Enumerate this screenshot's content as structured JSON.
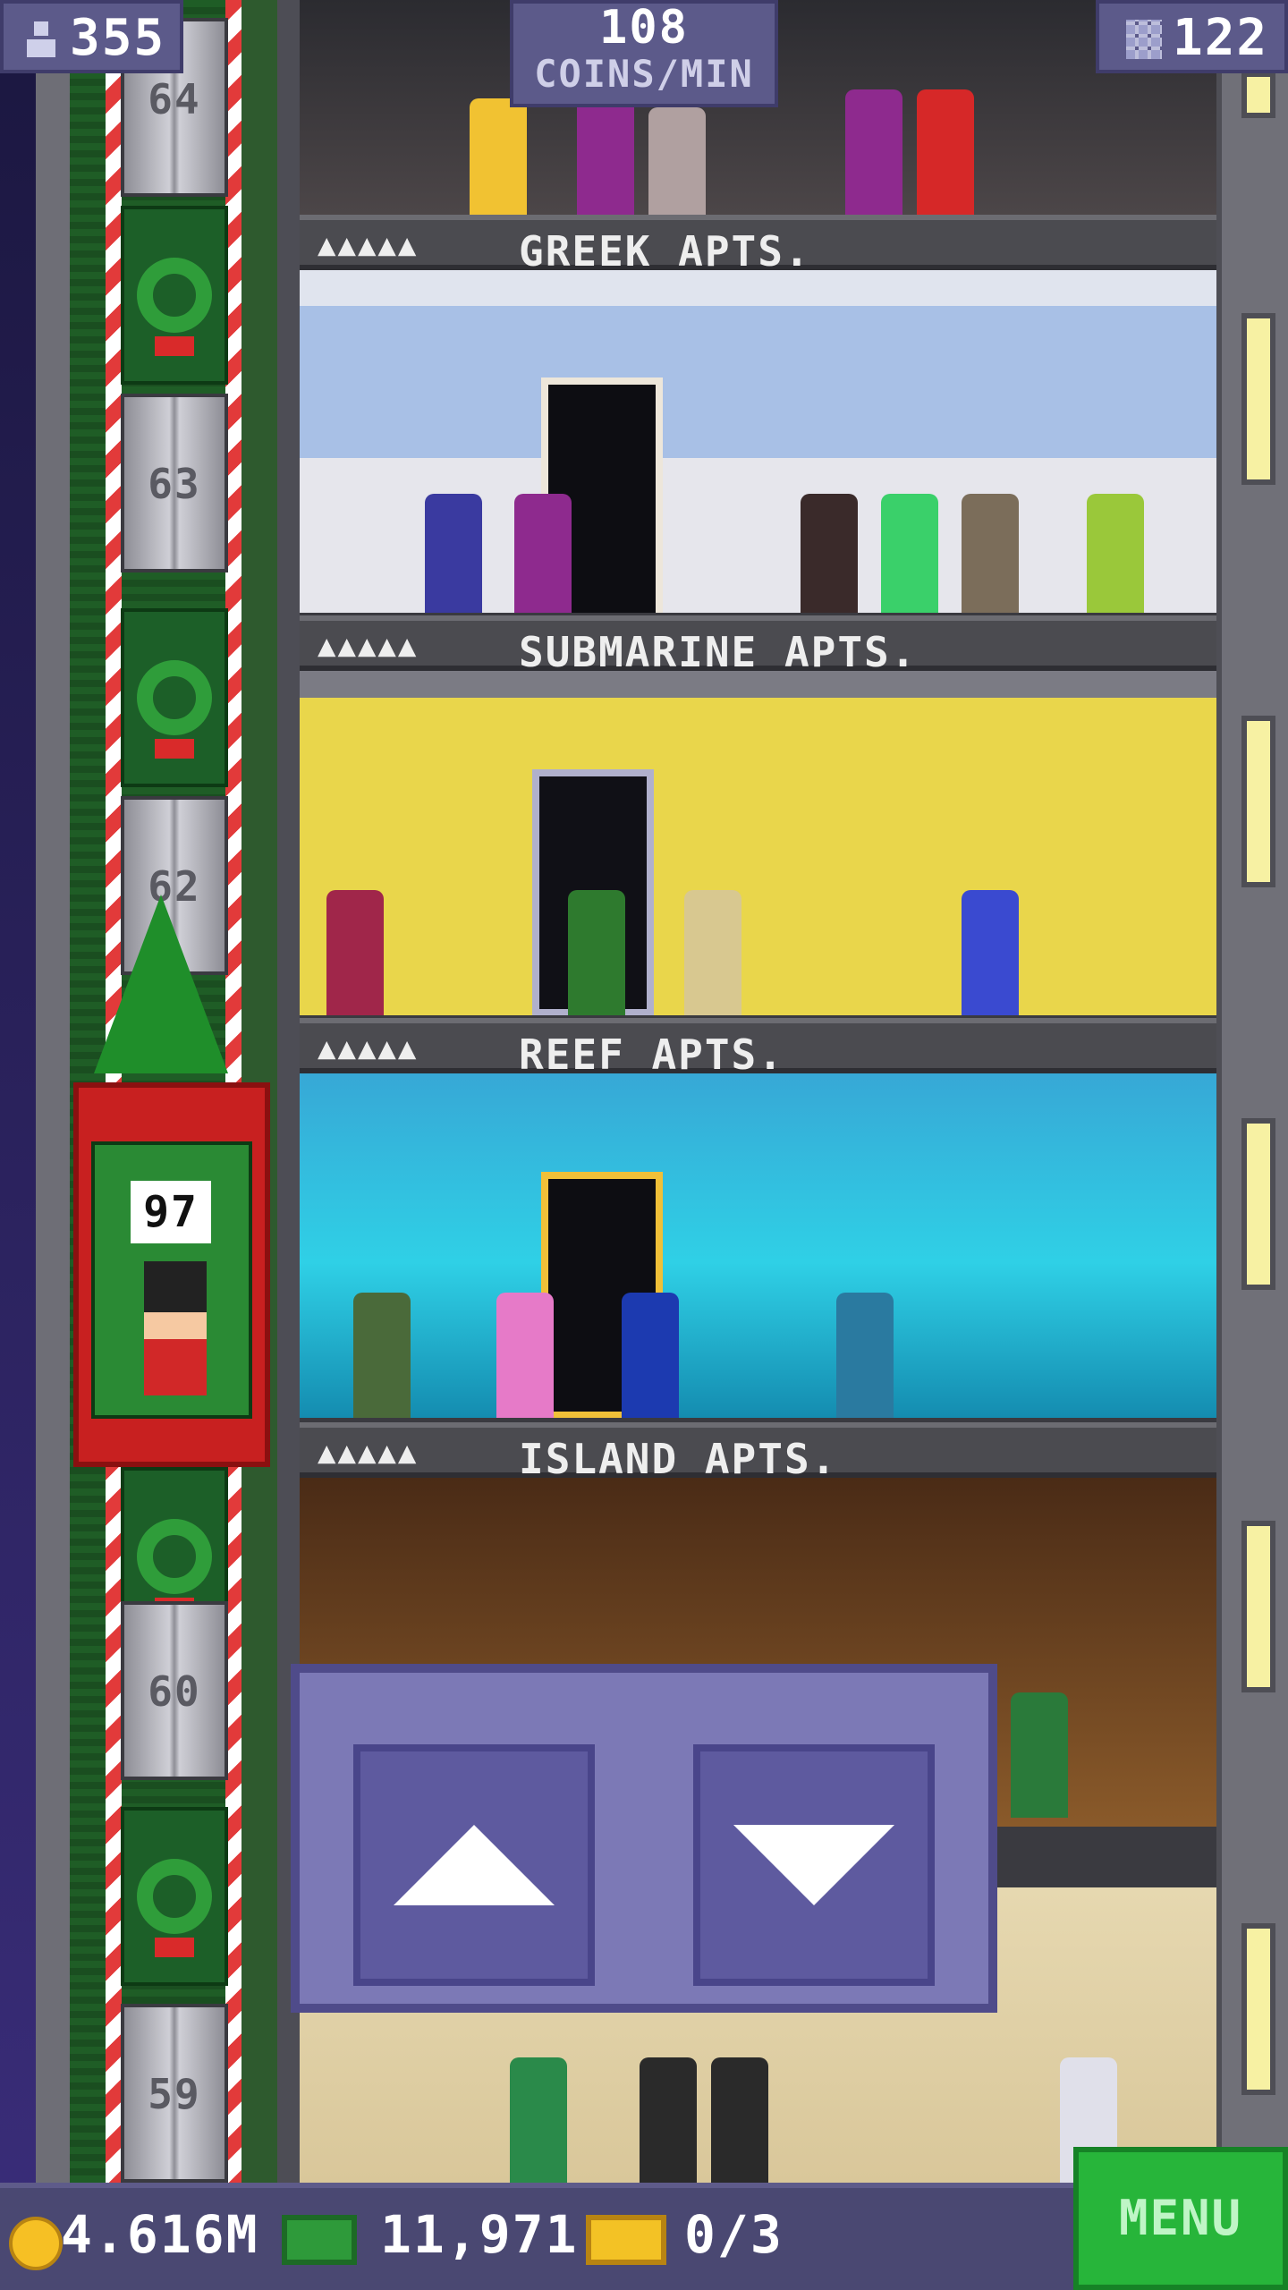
{
  "hud": {
    "population": "355",
    "coins_per_min_value": "108",
    "coins_per_min_label": "COINS/MIN",
    "floors": "122"
  },
  "elevator": {
    "floor_numbers": [
      "64",
      "63",
      "62",
      "60",
      "59"
    ],
    "car_floor": "97"
  },
  "floors": [
    {
      "label": "GREEK APTS.",
      "occupancy": "▲▲▲▲▲"
    },
    {
      "label": "SUBMARINE APTS.",
      "occupancy": "▲▲▲▲▲"
    },
    {
      "label": "REEF APTS.",
      "occupancy": "▲▲▲▲▲"
    },
    {
      "label": "ISLAND APTS.",
      "occupancy": "▲▲▲▲▲"
    }
  ],
  "bottom_bar": {
    "coins": "4.616M",
    "cash": "11,971",
    "tickets": "0/3",
    "menu_label": "MENU"
  },
  "colors": {
    "hud_bg": "#5c5a8a",
    "menu_bg": "#27b53a",
    "elevator_red": "#c82020"
  }
}
